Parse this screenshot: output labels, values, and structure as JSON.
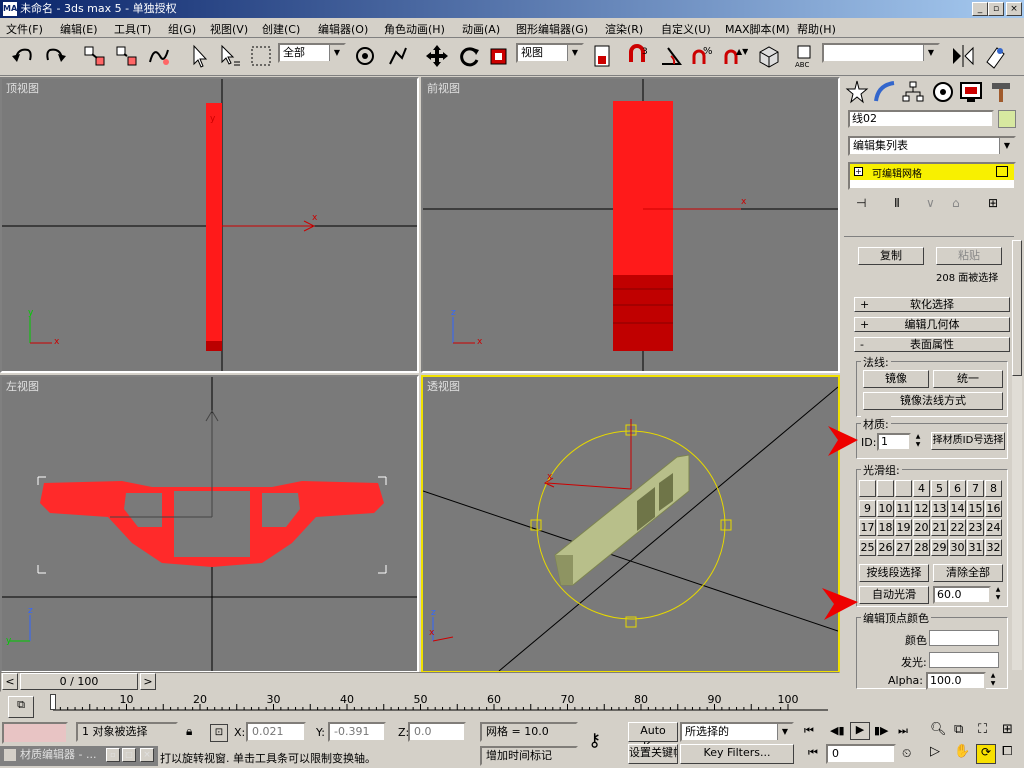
{
  "window": {
    "title": "未命名 - 3ds max 5 - 单独授权",
    "app_icon": "max-icon",
    "min": "_",
    "max": "▫",
    "close": "×"
  },
  "menu": [
    "文件(F)",
    "编辑(E)",
    "工具(T)",
    "组(G)",
    "视图(V)",
    "创建(C)",
    "编辑器(O)",
    "角色动画(H)",
    "动画(A)",
    "图形编辑器(G)",
    "渲染(R)",
    "自定义(U)",
    "MAX脚本(M)",
    "帮助(H)"
  ],
  "toolbar": {
    "selection_filter": "全部",
    "ref_coord": "视图",
    "named_selection": ""
  },
  "viewports": {
    "top": "顶视图",
    "front": "前视图",
    "left": "左视图",
    "perspective": "透视图"
  },
  "panel": {
    "object_name": "线02",
    "modifier_list": "编辑集列表",
    "stack_item": "可编辑网格",
    "copy": "复制",
    "paste": "粘贴",
    "face_count": "208 面被选择",
    "rollups": {
      "soft": "软化选择",
      "edit_geom": "编辑几何体",
      "surface": "表面属性"
    },
    "normals": {
      "title": "法线:",
      "flip": "镜像",
      "unify": "统一",
      "flip_mode": "镜像法线方式"
    },
    "material": {
      "title": "材质:",
      "id_label": "ID:",
      "id_value": "1",
      "select_by_id": "择材质ID号选择"
    },
    "smoothing": {
      "title": "光滑组:",
      "groups": [
        "",
        "",
        "",
        "4",
        "5",
        "6",
        "7",
        "8",
        "9",
        "10",
        "11",
        "12",
        "13",
        "14",
        "15",
        "16",
        "17",
        "18",
        "19",
        "20",
        "21",
        "22",
        "23",
        "24",
        "25",
        "26",
        "27",
        "28",
        "29",
        "30",
        "31",
        "32"
      ],
      "select_by": "按线段选择",
      "clear_all": "清除全部",
      "auto": "自动光滑",
      "auto_value": "60.0"
    },
    "vertex_colors": {
      "title": "编辑顶点颜色",
      "color": "颜色",
      "illum": "发光:",
      "alpha": "Alpha:",
      "alpha_value": "100.0"
    }
  },
  "timeline": {
    "slider": "0 / 100",
    "ticks": [
      "0",
      "10",
      "20",
      "30",
      "40",
      "50",
      "60",
      "70",
      "80",
      "90",
      "100"
    ]
  },
  "status": {
    "selected": "1 对象被选择",
    "x_label": "X:",
    "x": "0.021",
    "y_label": "Y:",
    "y": "-0.391",
    "z_label": "Z:",
    "z": "0.0",
    "grid": "网格 = 10.0",
    "auto_key": "Auto Key",
    "set_key_target": "所选择的",
    "set_key": "设置关键帧",
    "key_filters": "Key Filters...",
    "frame": "0",
    "prompt": "打以旋转视窗. 单击工具条可以限制变换轴。",
    "add_time_tag": "增加时间标记",
    "taskbar_item": "材质编辑器 - ..."
  }
}
